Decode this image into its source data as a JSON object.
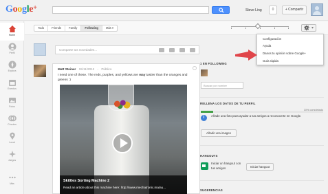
{
  "header": {
    "logo_text": "Google+",
    "username": "Steve Ling",
    "notification_count": "0",
    "share_label": "+ Compartir"
  },
  "nav": {
    "items": [
      {
        "label": "Home"
      },
      {
        "label": "Perfil"
      },
      {
        "label": "Explora"
      },
      {
        "label": "Eventos"
      },
      {
        "label": "Fotos"
      },
      {
        "label": "Círculos"
      },
      {
        "label": "Local"
      },
      {
        "label": "Juegos"
      },
      {
        "label": "Más"
      }
    ]
  },
  "stream": {
    "filters": [
      "Todo",
      "Friends",
      "Family",
      "Following",
      "Más ▾"
    ],
    "active_filter": "Following",
    "slider_value": 3,
    "slider_max": 5,
    "placeholder": "Comparte tus novedades..."
  },
  "dropdown": {
    "items": [
      "Configuración",
      "Ayuda",
      "Danos tu opinión sobre Google+",
      "Guía rápida"
    ],
    "highlighted": "Danos tu opinión sobre Google+"
  },
  "post": {
    "author": "Matt Steiner",
    "date": "15/11/2012",
    "visibility": "Público",
    "text_before": "I need one of these.  The reds, purples, and yellows are ",
    "text_bold": "way",
    "text_after": " tastier than the oranges and greens :)",
    "video_title": "Skittles Sorting Machine 2",
    "video_desc": "Read an article about this machine here: http://www.mechatronic.ma/au..."
  },
  "right": {
    "following_title": "1 EN FOLLOWING",
    "search_placeholder": "Buscar por nombre",
    "profile_title": "RELLENA LOS DATOS DE TU PERFIL",
    "progress_percent": 10,
    "progress_label": "10% completado",
    "help_text": "Añade una foto para ayudar a tus amigos a reconocerte en Google.",
    "add_image_label": "Añadir una imagen",
    "hangouts_title": "HANGOUTS",
    "hangout_text": "Iniciar un hangout con tus amigos",
    "hangout_button": "Iniciar hangout",
    "suggestions_title": "SUGERENCIAS"
  },
  "colors": {
    "accent_blue": "#4d90fe",
    "arrow_red": "#e0454a",
    "progress_green": "#43a047"
  }
}
